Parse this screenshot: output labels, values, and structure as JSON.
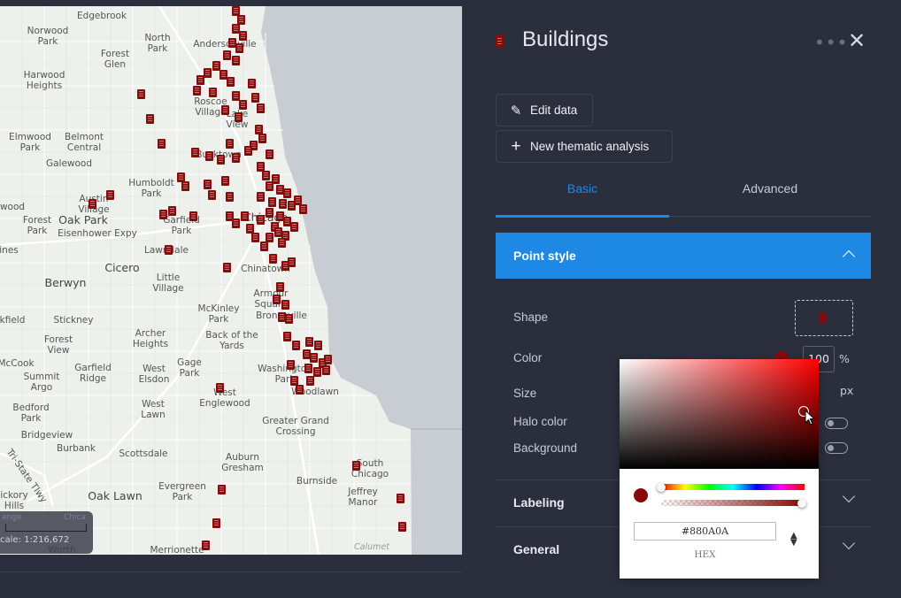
{
  "map": {
    "scale_label": "cale: 1:216,672",
    "scale_ticks": [
      "ange",
      "Chica"
    ],
    "place_labels": [
      {
        "text": "Edgebrook"
      },
      {
        "text": "Norwood\nPark"
      },
      {
        "text": "North\nPark"
      },
      {
        "text": "Andersonville"
      },
      {
        "text": "Forest\nGlen"
      },
      {
        "text": "Harwood\nHeights"
      },
      {
        "text": "Roscoe\nVillage"
      },
      {
        "text": "Lake\nView"
      },
      {
        "text": "Elmwood\nPark"
      },
      {
        "text": "Belmont\nCentral"
      },
      {
        "text": "Galewood"
      },
      {
        "text": "Bucktown"
      },
      {
        "text": "Humboldt\nPark"
      },
      {
        "text": "Austin\nVillage"
      },
      {
        "text": "Oak Park"
      },
      {
        "text": "Forest\nPark"
      },
      {
        "text": "wood"
      },
      {
        "text": "Garfield\nPark"
      },
      {
        "text": "Eisenhower Expy"
      },
      {
        "text": "Lawndale"
      },
      {
        "text": "ines"
      },
      {
        "text": "Cicero"
      },
      {
        "text": "Chinatown"
      },
      {
        "text": "Berwyn"
      },
      {
        "text": "Little\nVillage"
      },
      {
        "text": "Armour\nSquare"
      },
      {
        "text": "McKinley\nPark"
      },
      {
        "text": "Bronzeville"
      },
      {
        "text": "kfield"
      },
      {
        "text": "Stickney"
      },
      {
        "text": "Archer\nHeights"
      },
      {
        "text": "Back of the\nYards"
      },
      {
        "text": "Forest\nView"
      },
      {
        "text": "McCook"
      },
      {
        "text": "Garfield\nRidge"
      },
      {
        "text": "West\nElsdon"
      },
      {
        "text": "Gage\nPark"
      },
      {
        "text": "Washington\nPark"
      },
      {
        "text": "Summit\nArgo"
      },
      {
        "text": "West\nEnglewood"
      },
      {
        "text": "Woodlawn"
      },
      {
        "text": "Bedford\nPark"
      },
      {
        "text": "West\nLawn"
      },
      {
        "text": "Greater Grand\nCrossing"
      },
      {
        "text": "Bridgeview"
      },
      {
        "text": "Burbank"
      },
      {
        "text": "Scottsdale"
      },
      {
        "text": "Auburn\nGresham"
      },
      {
        "text": "South\nChicago"
      },
      {
        "text": "Burnside"
      },
      {
        "text": "Tri-State Tlwy"
      },
      {
        "text": "Evergreen\nPark"
      },
      {
        "text": "Oak Lawn"
      },
      {
        "text": "Jeffrey\nManor"
      },
      {
        "text": "ickory\nHills"
      },
      {
        "text": "Merrionette"
      },
      {
        "text": "Calumet"
      },
      {
        "text": "Worth"
      },
      {
        "text": "Chicago"
      }
    ]
  },
  "panel": {
    "layer_icon": "building-icon",
    "title": "Buildings",
    "more_icon": "more-icon",
    "close_icon": "close-icon",
    "edit_data_label": "Edit data",
    "new_analysis_label": "New thematic analysis",
    "tabs": [
      {
        "label": "Basic",
        "active": true
      },
      {
        "label": "Advanced",
        "active": false
      }
    ],
    "sections": {
      "point_style": "Point style",
      "labeling": "Labeling",
      "general": "General"
    },
    "rows": {
      "shape": "Shape",
      "color": "Color",
      "size": "Size",
      "halo_color": "Halo color",
      "background": "Background"
    },
    "opacity_value": "100",
    "opacity_unit": "%",
    "size_unit": "px",
    "accent_color": "#1E88E5",
    "point_color": "#880A0A"
  },
  "color_picker": {
    "hex_value": "#880A0A",
    "format_label": "HEX",
    "alpha": 1.0
  }
}
